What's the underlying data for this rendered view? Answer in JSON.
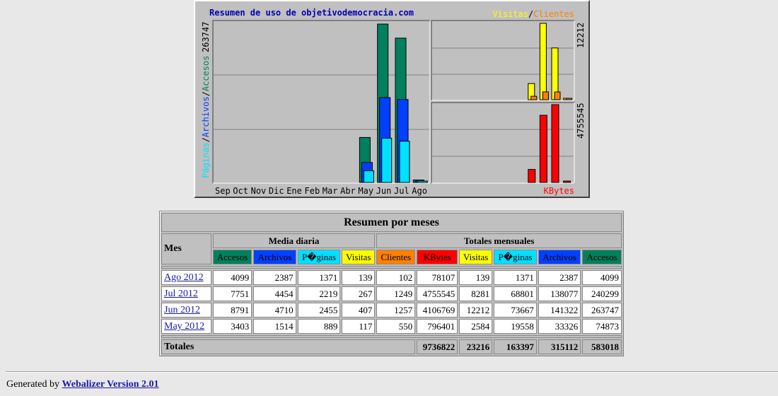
{
  "chart": {
    "title": "Resumen de uso de objetivodemocracia.com",
    "legend_top": {
      "visitas": "Visitas",
      "sep": "/",
      "clientes": "Clientes"
    },
    "legend_bottom": "KBytes",
    "left_axis": {
      "paginas": "Páginas",
      "sep1": "/",
      "archivos": "Archivos",
      "sep2": "/",
      "accesos": "Accesos"
    },
    "left_max_label": "263747",
    "right_top_max_label": "12212",
    "right_bottom_max_label": "4755545",
    "colors": {
      "accesos": "#00805c",
      "archivos": "#0040ff",
      "paginas": "#00e0ff",
      "visitas": "#ffff00",
      "clientes": "#ff8000",
      "kbytes": "#ff0000",
      "title": "#0000b0",
      "background": "#c0c0c0"
    }
  },
  "chart_data": {
    "type": "bar",
    "categories": [
      "Sep",
      "Oct",
      "Nov",
      "Dic",
      "Ene",
      "Feb",
      "Mar",
      "Abr",
      "May",
      "Jun",
      "Jul",
      "Ago"
    ],
    "series": [
      {
        "name": "Accesos",
        "values": [
          0,
          0,
          0,
          0,
          0,
          0,
          0,
          0,
          74873,
          263747,
          240299,
          4099
        ]
      },
      {
        "name": "Archivos",
        "values": [
          0,
          0,
          0,
          0,
          0,
          0,
          0,
          0,
          33326,
          141322,
          138077,
          2387
        ]
      },
      {
        "name": "Páginas",
        "values": [
          0,
          0,
          0,
          0,
          0,
          0,
          0,
          0,
          19558,
          73667,
          68801,
          1371
        ]
      },
      {
        "name": "Visitas",
        "values": [
          0,
          0,
          0,
          0,
          0,
          0,
          0,
          0,
          2584,
          12212,
          8281,
          139
        ]
      },
      {
        "name": "Clientes",
        "values": [
          0,
          0,
          0,
          0,
          0,
          0,
          0,
          0,
          550,
          1257,
          1249,
          102
        ]
      },
      {
        "name": "KBytes",
        "values": [
          0,
          0,
          0,
          0,
          0,
          0,
          0,
          0,
          796401,
          4106769,
          4755545,
          78107
        ]
      }
    ],
    "title": "Resumen de uso de objetivodemocracia.com",
    "ylim_left": [
      0,
      263747
    ],
    "ylim_right_top": [
      0,
      12212
    ],
    "ylim_right_bottom": [
      0,
      4755545
    ],
    "grid": true
  },
  "table": {
    "title": "Resumen por meses",
    "mes_label": "Mes",
    "group_daily": "Media diaria",
    "group_monthly": "Totales mensuales",
    "columns": {
      "accesos": "Accesos",
      "archivos": "Archivos",
      "paginas": "P�ginas",
      "visitas": "Visitas",
      "clientes": "Clientes",
      "kbytes": "KBytes"
    },
    "rows": [
      {
        "month": "Ago 2012",
        "d_acc": "4099",
        "d_arc": "2387",
        "d_pag": "1371",
        "d_vis": "139",
        "cli": "102",
        "kb": "78107",
        "vis": "139",
        "pag": "1371",
        "arc": "2387",
        "acc": "4099"
      },
      {
        "month": "Jul 2012",
        "d_acc": "7751",
        "d_arc": "4454",
        "d_pag": "2219",
        "d_vis": "267",
        "cli": "1249",
        "kb": "4755545",
        "vis": "8281",
        "pag": "68801",
        "arc": "138077",
        "acc": "240299"
      },
      {
        "month": "Jun 2012",
        "d_acc": "8791",
        "d_arc": "4710",
        "d_pag": "2455",
        "d_vis": "407",
        "cli": "1257",
        "kb": "4106769",
        "vis": "12212",
        "pag": "73667",
        "arc": "141322",
        "acc": "263747"
      },
      {
        "month": "May 2012",
        "d_acc": "3403",
        "d_arc": "1514",
        "d_pag": "889",
        "d_vis": "117",
        "cli": "550",
        "kb": "796401",
        "vis": "2584",
        "pag": "19558",
        "arc": "33326",
        "acc": "74873"
      }
    ],
    "totals": {
      "label": "Totales",
      "kb": "9736822",
      "vis": "23216",
      "pag": "163397",
      "arc": "315112",
      "acc": "583018"
    }
  },
  "footer": {
    "prefix": "Generated by",
    "link": "Webalizer Version 2.01"
  }
}
